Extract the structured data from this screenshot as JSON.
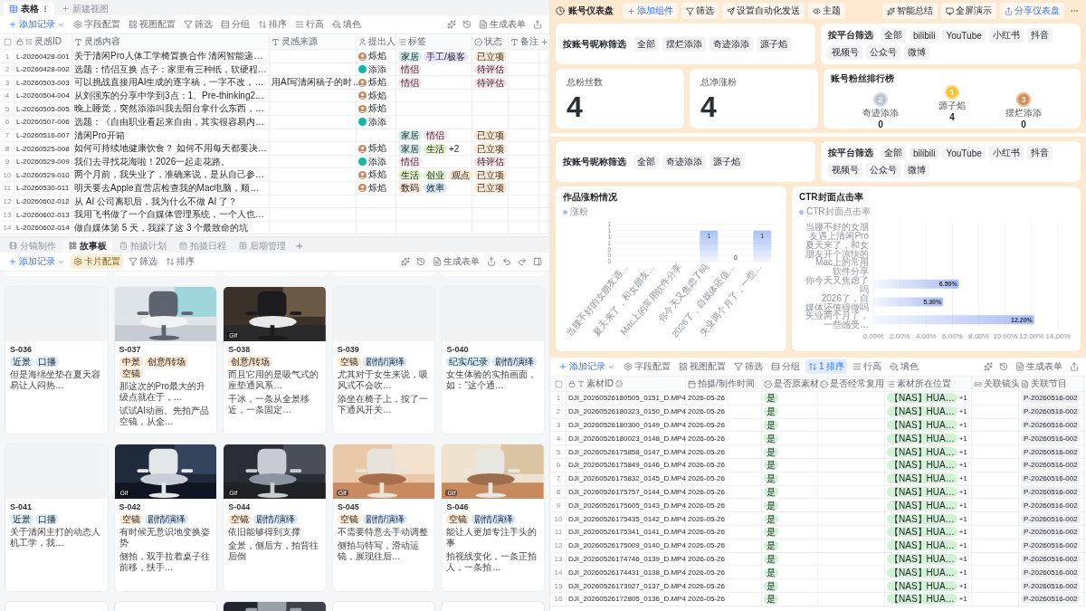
{
  "left_table": {
    "views": [
      {
        "label": "表格",
        "selected": true
      }
    ],
    "new_view": "新建视图",
    "toolbar": {
      "add": "添加记录",
      "tools": [
        {
          "kind": "fields",
          "label": "字段配置",
          "active": false
        },
        {
          "kind": "view",
          "label": "视图配置",
          "active": false
        },
        {
          "kind": "filter",
          "label": "筛选",
          "active": false
        },
        {
          "kind": "group",
          "label": "分组",
          "active": false
        },
        {
          "kind": "sort",
          "label": "排序",
          "active": false
        },
        {
          "kind": "height",
          "label": "行高",
          "active": false
        },
        {
          "kind": "fill",
          "label": "填色",
          "active": false
        }
      ],
      "generate": "生成表单"
    },
    "columns": [
      "灵感ID",
      "灵感内容",
      "灵感来源",
      "提出人",
      "标签",
      "状态",
      "备注"
    ],
    "rows": [
      {
        "n": "1",
        "id": "L-20260428-001",
        "content": "关于清闲Pro人体工学椅置换合作 清闲智能递…",
        "person": {
          "name": "烁焰"
        },
        "tags": [
          {
            "label": "家居",
            "color": "#d3f0ec"
          },
          {
            "label": "手工/极客",
            "color": "#e8e2fb"
          }
        ],
        "status": {
          "label": "已立项",
          "color": "#fde8cf"
        }
      },
      {
        "n": "2",
        "id": "L-20260428-002",
        "content": "选题：情侣互换 点子：家里有三种纸，软硬程…",
        "person": {
          "name": "添添",
          "kind": "badge"
        },
        "tags": [
          {
            "label": "情侣",
            "color": "#fbe1ea"
          }
        ],
        "status": {
          "label": "待评估",
          "color": "#fbe1e6"
        }
      },
      {
        "n": "3",
        "id": "L-20260503-003",
        "content": "可以挑战直接用AI生成的逐字稿，一字不改，…",
        "source": "用AI写清闲稿子的时…",
        "person": {
          "name": "烁焰"
        },
        "tags": [
          {
            "label": "情侣",
            "color": "#fbe1ea"
          }
        ],
        "status": {
          "label": "待评估",
          "color": "#fbe1e6"
        }
      },
      {
        "n": "4",
        "id": "L-20260504-004",
        "content": "从刘强东的分享中学到3点：1、Pre-thinking2…",
        "person": {
          "name": "烁焰"
        }
      },
      {
        "n": "5",
        "id": "L-20260505-005",
        "content": "晚上睡觉，突然添添叫我去阳台拿什么东西，…",
        "person": {
          "name": "烁焰"
        }
      },
      {
        "n": "6",
        "id": "L-20260507-006",
        "content": "选题：《自由职业看起来自由，其实很容易内…",
        "person": {
          "name": "添添",
          "kind": "badge"
        }
      },
      {
        "n": "7",
        "id": "L-20260516-007",
        "content": "清闲Pro开箱",
        "tags": [
          {
            "label": "家居",
            "color": "#d3f0ec"
          },
          {
            "label": "情侣",
            "color": "#fbe1ea"
          }
        ],
        "status": {
          "label": "已立项",
          "color": "#fde8cf"
        }
      },
      {
        "n": "8",
        "id": "L-20260525-008",
        "content": "如何可持续地健康饮食？ 如何不用每天都要决…",
        "person": {
          "name": "烁焰"
        },
        "tags": [
          {
            "label": "家居",
            "color": "#d3f0ec"
          },
          {
            "label": "生活",
            "color": "#e3f1c9"
          }
        ],
        "more": "+2",
        "status": {
          "label": "已立项",
          "color": "#fde8cf"
        }
      },
      {
        "n": "9",
        "id": "L-20260529-009",
        "content": "我们去寻找花海啦！2026一起走花路。",
        "person": {
          "name": "添添",
          "kind": "badge"
        },
        "tags": [
          {
            "label": "情侣",
            "color": "#fbe1ea"
          }
        ],
        "status": {
          "label": "待评估",
          "color": "#fbe1e6"
        }
      },
      {
        "n": "10",
        "id": "L-20260529-010",
        "content": "两个月前，我失业了，准确来说，是从自己参…",
        "person": {
          "name": "烁焰"
        },
        "tags": [
          {
            "label": "生活",
            "color": "#e3f1c9"
          },
          {
            "label": "创业",
            "color": "#dff3d3"
          },
          {
            "label": "观点",
            "color": "#fde6cf"
          }
        ],
        "status": {
          "label": "已立项",
          "color": "#fde8cf"
        }
      },
      {
        "n": "11",
        "id": "L-20260530-011",
        "content": "明天要去Apple直营店检查我的Mac电脑，顺…",
        "person": {
          "name": "烁焰"
        },
        "tags": [
          {
            "label": "数码",
            "color": "#fde4cf"
          },
          {
            "label": "效率",
            "color": "#d5ebfb"
          }
        ],
        "status": {
          "label": "已立项",
          "color": "#fde8cf"
        }
      },
      {
        "n": "12",
        "id": "L-20260602-012",
        "content": "从 AI 公司离职后，我为什么不做 AI 了？"
      },
      {
        "n": "13",
        "id": "L-20260602-013",
        "content": "我用飞书做了一个自媒体管理系统，一个人也…"
      },
      {
        "n": "14",
        "id": "L-20260602-014",
        "content": "做自媒体第 5 天，我踩了这 3 个最致命的坑"
      }
    ]
  },
  "gallery": {
    "tabs": [
      {
        "label": "分镜制作",
        "selected": false
      },
      {
        "label": "故事板",
        "selected": true
      },
      {
        "label": "拍摄计划",
        "selected": false
      },
      {
        "label": "拍摄日程",
        "selected": false
      },
      {
        "label": "后期管理",
        "selected": false
      }
    ],
    "toolbar": {
      "add": "添加记录",
      "tools": [
        {
          "kind": "card",
          "label": "卡片配置",
          "active": true
        },
        {
          "kind": "filter",
          "label": "筛选",
          "active": false
        },
        {
          "kind": "sort",
          "label": "排序",
          "active": false
        }
      ],
      "generate": "生成表单"
    },
    "peek_top": [
      {
        "image": false
      },
      {
        "image": false
      },
      {
        "image": false
      },
      {
        "image": false
      },
      {
        "image": false
      }
    ],
    "cards": [
      {
        "id": "S-036",
        "image": false,
        "tags": [
          {
            "label": "近景",
            "color": "#d9ecfc"
          },
          {
            "label": "口播",
            "color": "#d9ecfc"
          }
        ],
        "lines": [
          "但是海绵坐垫在夏天容易让人闷热…"
        ]
      },
      {
        "id": "S-037",
        "image": true,
        "tags": [
          {
            "label": "中景",
            "color": "#fde6cc"
          },
          {
            "label": "创意/转场",
            "color": "#fde6cc"
          },
          {
            "label": "空镜",
            "color": "#fde6cc"
          }
        ],
        "lines": [
          "那这次的Pro最大的升级点就在于，…",
          "试试AI动画。先拍产品空镜，从全…"
        ]
      },
      {
        "id": "S-038",
        "image": true,
        "badge": "Gif",
        "tags": [
          {
            "label": "创意/转场",
            "color": "#fde6cc"
          }
        ],
        "lines": [
          "而且它用的是吸气式的座垫通风系…",
          "干冰，一条从全景移近，一条固定…"
        ]
      },
      {
        "id": "S-039",
        "image": false,
        "tags": [
          {
            "label": "空镜",
            "color": "#fde6cc"
          },
          {
            "label": "剧情/演绎",
            "color": "#d6e8fb"
          }
        ],
        "lines": [
          "尤其对于女生来说，吸风式不会吹…",
          "添坐在椅子上，按了一下通风开关…"
        ]
      },
      {
        "id": "S-040",
        "image": false,
        "tags": [
          {
            "label": "纪实/记录",
            "color": "#d2ecf5"
          },
          {
            "label": "剧情/演绎",
            "color": "#d6e8fb"
          }
        ],
        "lines": [
          "女生体验的实拍画面，如：“这个通…"
        ]
      },
      {
        "id": "S-041",
        "image": false,
        "tags": [
          {
            "label": "近景",
            "color": "#d9ecfc"
          },
          {
            "label": "口播",
            "color": "#d9ecfc"
          }
        ],
        "lines": [
          "关于清闲主打的动态人机工学，我…"
        ]
      },
      {
        "id": "S-042",
        "image": true,
        "badge": "Gif",
        "tags": [
          {
            "label": "空镜",
            "color": "#fde6cc"
          },
          {
            "label": "剧情/演绎",
            "color": "#d6e8fb"
          }
        ],
        "lines": [
          "有时候无意识地变换姿势",
          "侧拍，双手拉着桌子往前移，扶手…"
        ]
      },
      {
        "id": "S-044",
        "image": true,
        "badge": "Gif",
        "tags": [
          {
            "label": "空镜",
            "color": "#fde6cc"
          },
          {
            "label": "剧情/演绎",
            "color": "#d6e8fb"
          }
        ],
        "lines": [
          "依旧能够得到支撑",
          "全景，侧后方，拍背往后倒"
        ]
      },
      {
        "id": "S-045",
        "image": true,
        "badge": "Gif",
        "tags": [
          {
            "label": "空镜",
            "color": "#fde6cc"
          },
          {
            "label": "剧情/演绎",
            "color": "#d6e8fb"
          }
        ],
        "lines": [
          "不需要特意去手动调整",
          "侧拍与特写，滑动运镜，展现往后…"
        ]
      },
      {
        "id": "S-046",
        "image": true,
        "badge": "Gif",
        "tags": [
          {
            "label": "空镜",
            "color": "#fde6cc"
          },
          {
            "label": "剧情/演绎",
            "color": "#d6e8fb"
          }
        ],
        "lines": [
          "能让人更加专注手头的事",
          "拍视线变化，一条正拍人，一条拍…"
        ]
      }
    ],
    "peek_bottom": [
      {
        "image": false
      },
      {
        "image": false
      },
      {
        "image": true
      },
      {
        "image": false
      },
      {
        "image": false
      }
    ]
  },
  "dashboard": {
    "title": "账号仪表盘",
    "actions": [
      {
        "kind": "add",
        "label": "添加组件",
        "primary": true
      },
      {
        "kind": "filter",
        "label": "筛选",
        "primary": false
      },
      {
        "kind": "automation",
        "label": "设置自动化发送",
        "primary": false
      },
      {
        "kind": "theme",
        "label": "主题",
        "primary": false
      }
    ],
    "right_actions": [
      {
        "kind": "summary",
        "label": "智能总结",
        "primary": false
      },
      {
        "kind": "present",
        "label": "全屏演示",
        "primary": false
      },
      {
        "kind": "share",
        "label": "分享仪表盘",
        "primary": true
      }
    ],
    "top": {
      "filters": [
        {
          "label": "按账号昵称筛选",
          "options": [
            "全部",
            "摆烂添添",
            "奇迹添添",
            "源子焰"
          ]
        },
        {
          "label": "按平台筛选",
          "options": [
            "全部",
            "bilibili",
            "YouTube",
            "小红书",
            "抖音",
            "视频号",
            "公众号",
            "微博"
          ]
        }
      ],
      "stats": [
        {
          "label": "总粉丝数",
          "value": "4"
        },
        {
          "label": "总净涨粉",
          "value": "4"
        }
      ],
      "ranking": {
        "title": "账号粉丝排行榜",
        "entries": [
          {
            "rank": "2",
            "name": "奇迹添添",
            "value": "0",
            "color": "#b9c2cf"
          },
          {
            "rank": "1",
            "name": "源子焰",
            "value": "4",
            "color": "#f6c12a"
          },
          {
            "rank": "3",
            "name": "摆烂添添",
            "value": "0",
            "color": "#d9894f"
          }
        ]
      }
    },
    "bottom": {
      "filters": [
        {
          "label": "按账号昵称筛选",
          "options": [
            "全部",
            "奇迹添添",
            "源子焰"
          ]
        },
        {
          "label": "按平台筛选",
          "options": [
            "全部",
            "bilibili",
            "YouTube",
            "小红书",
            "抖音",
            "视频号",
            "公众号",
            "微博"
          ]
        }
      ],
      "charts": [
        {
          "chart_data": {
            "type": "bar",
            "grid": true,
            "title": "作品涨粉情况",
            "categories": [
              "当腰不好的女朋友遇…",
              "夏天来了，和女朋友…",
              "Mac上的常用软件分享",
              "你今天又焦虑了吗",
              "2026了，自媒体还值…",
              "失业两个月了，一些…"
            ],
            "series": [
              {
                "name": "涨粉",
                "color": "#a9c1f5",
                "values": [
                  0,
                  0,
                  0,
                  1,
                  0,
                  1
                ]
              }
            ],
            "ylim": [
              0,
              1.2
            ],
            "yticks": [
              {
                "value": 0,
                "label": "0"
              },
              {
                "value": 0.2,
                "label": "0"
              },
              {
                "value": 0.4,
                "label": "0"
              },
              {
                "value": 0.6,
                "label": "1"
              },
              {
                "value": 0.8,
                "label": "1"
              },
              {
                "value": 1,
                "label": "1"
              },
              {
                "value": 1.2,
                "label": "1"
              }
            ],
            "value_labels": [
              null,
              null,
              null,
              "1",
              "0",
              "1"
            ]
          }
        },
        {
          "chart_data": {
            "type": "bar",
            "grid": true,
            "orientation": "horizontal",
            "title": "CTR封面点击率",
            "categories": [
              "当腰不好的女朋友遇上清闲Pro",
              "夏天来了，和女朋友开个凉快的",
              "Mac上的常用软件分享",
              "你今天又焦虑了吗",
              "2026了，自媒体还值得做吗",
              "失业两个月了，一些感受…"
            ],
            "series": [
              {
                "name": "CTR封面点击率",
                "color": "#a9bdf5",
                "values": [
                  null,
                  null,
                  null,
                  6.5,
                  5.3,
                  12.2
                ]
              }
            ],
            "xlim": [
              0,
              14
            ],
            "xticks": [
              {
                "value": 0,
                "label": "0.00%"
              },
              {
                "value": 2,
                "label": "2.00%"
              },
              {
                "value": 4,
                "label": "4.00%"
              },
              {
                "value": 6,
                "label": "6.00%"
              },
              {
                "value": 8,
                "label": "8.00%"
              },
              {
                "value": 10,
                "label": "10.00%"
              },
              {
                "value": 12,
                "label": "12.00%"
              },
              {
                "value": 14,
                "label": "14.00%"
              }
            ],
            "value_labels": [
              null,
              null,
              null,
              "6.50%",
              "5.30%",
              "12.20%"
            ]
          }
        }
      ]
    }
  },
  "right_table": {
    "toolbar": {
      "add": "添加记录",
      "tools": [
        {
          "kind": "fields",
          "label": "字段配置",
          "active": false
        },
        {
          "kind": "view",
          "label": "视图配置",
          "active": false
        },
        {
          "kind": "filter",
          "label": "筛选",
          "active": false
        },
        {
          "kind": "group",
          "label": "分组",
          "active": false
        },
        {
          "kind": "sort",
          "label": "1 排序",
          "active": true
        },
        {
          "kind": "height",
          "label": "行高",
          "active": false
        },
        {
          "kind": "fill",
          "label": "填色",
          "active": false
        }
      ],
      "generate": "生成表单"
    },
    "columns": [
      "素材ID",
      "拍摄/制作时间",
      "是否原素材",
      "是否经常复用",
      "素材所在位置",
      "关联镜头",
      "关联节目"
    ],
    "rows": [
      {
        "n": "1",
        "file": "DJI_20260526180505_0151_D.MP4",
        "date": "2026-05-26",
        "original": "是",
        "location": "【NAS】HUA…",
        "more": "+1",
        "program": "P-20260516-002"
      },
      {
        "n": "2",
        "file": "DJI_20260526180323_0150_D.MP4",
        "date": "2026-05-26",
        "original": "是",
        "location": "【NAS】HUA…",
        "more": "+1",
        "program": "P-20260516-002"
      },
      {
        "n": "3",
        "file": "DJI_20260526180300_0149_D.MP4",
        "date": "2026-05-26",
        "original": "是",
        "location": "【NAS】HUA…",
        "more": "+1",
        "program": "P-20260516-002"
      },
      {
        "n": "4",
        "file": "DJI_20260526180023_0148_D.MP4",
        "date": "2026-05-26",
        "original": "是",
        "location": "【NAS】HUA…",
        "more": "+1",
        "program": "P-20260516-002"
      },
      {
        "n": "5",
        "file": "DJI_20260526175858_0147_D.MP4",
        "date": "2026-05-26",
        "original": "是",
        "location": "【NAS】HUA…",
        "more": "+1",
        "program": "P-20260516-002"
      },
      {
        "n": "6",
        "file": "DJI_20260526175849_0146_D.MP4",
        "date": "2026-05-26",
        "original": "是",
        "location": "【NAS】HUA…",
        "more": "+1",
        "program": "P-20260516-002"
      },
      {
        "n": "7",
        "file": "DJI_20260526175832_0145_D.MP4",
        "date": "2026-05-26",
        "original": "是",
        "location": "【NAS】HUA…",
        "more": "+1",
        "program": "P-20260516-002"
      },
      {
        "n": "8",
        "file": "DJI_20260526175757_0144_D.MP4",
        "date": "2026-05-26",
        "original": "是",
        "location": "【NAS】HUA…",
        "more": "+1",
        "program": "P-20260516-002"
      },
      {
        "n": "9",
        "file": "DJI_20260526175605_0143_D.MP4",
        "date": "2026-05-26",
        "original": "是",
        "location": "【NAS】HUA…",
        "more": "+1",
        "program": "P-20260516-002"
      },
      {
        "n": "10",
        "file": "DJI_20260526175435_0142_D.MP4",
        "date": "2026-05-26",
        "original": "是",
        "location": "【NAS】HUA…",
        "more": "+1",
        "program": "P-20260516-002"
      },
      {
        "n": "11",
        "file": "DJI_20260526175341_0141_D.MP4",
        "date": "2026-05-26",
        "original": "是",
        "location": "【NAS】HUA…",
        "more": "+1",
        "program": "P-20260516-002"
      },
      {
        "n": "12",
        "file": "DJI_20260526175009_0140_D.MP4",
        "date": "2026-05-26",
        "original": "是",
        "location": "【NAS】HUA…",
        "more": "+1",
        "program": "P-20260516-002"
      },
      {
        "n": "13",
        "file": "DJI_20260526174746_0139_D.MP4",
        "date": "2026-05-26",
        "original": "是",
        "location": "【NAS】HUA…",
        "more": "+1",
        "program": "P-20260516-002"
      },
      {
        "n": "14",
        "file": "DJI_20260526174431_0138_D.MP4",
        "date": "2026-05-26",
        "original": "是",
        "location": "【NAS】HUA…",
        "more": "+1",
        "program": "P-20260516-002"
      },
      {
        "n": "15",
        "file": "DJI_20260526173927_0137_D.MP4",
        "date": "2026-05-26",
        "original": "是",
        "location": "【NAS】HUA…",
        "more": "+1",
        "program": "P-20260516-002"
      },
      {
        "n": "16",
        "file": "DJI_20260526172805_0136_D.MP4",
        "date": "2026-05-26",
        "original": "是",
        "location": "【NAS】HUA…",
        "more": "+1",
        "program": "P-20260516-002"
      }
    ]
  }
}
